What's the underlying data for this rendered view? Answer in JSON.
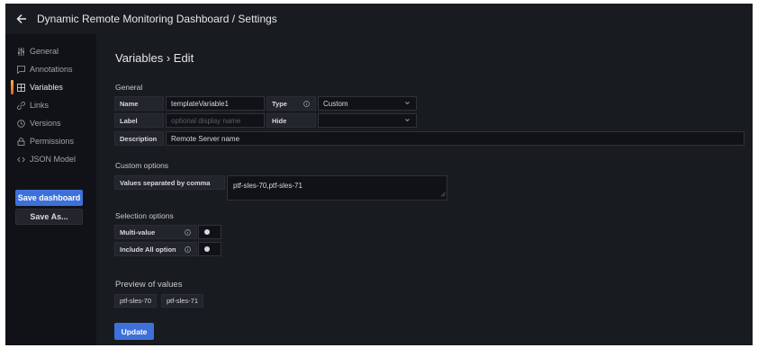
{
  "header": {
    "title": "Dynamic Remote Monitoring Dashboard / Settings"
  },
  "sidebar": {
    "items": [
      {
        "label": "General",
        "icon": "sliders-icon"
      },
      {
        "label": "Annotations",
        "icon": "comment-icon"
      },
      {
        "label": "Variables",
        "icon": "calculator-icon",
        "active": true
      },
      {
        "label": "Links",
        "icon": "link-icon"
      },
      {
        "label": "Versions",
        "icon": "history-icon"
      },
      {
        "label": "Permissions",
        "icon": "lock-icon"
      },
      {
        "label": "JSON Model",
        "icon": "code-icon"
      }
    ],
    "save_dashboard": "Save dashboard",
    "save_as": "Save As..."
  },
  "main": {
    "heading": "Variables › Edit",
    "general": {
      "section_title": "General",
      "name_label": "Name",
      "name_value": "templateVariable1",
      "type_label": "Type",
      "type_value": "Custom",
      "label_label": "Label",
      "label_placeholder": "optional display name",
      "hide_label": "Hide",
      "hide_value": "",
      "description_label": "Description",
      "description_value": "Remote Server name"
    },
    "custom_options": {
      "section_title": "Custom options",
      "values_label": "Values separated by comma",
      "values_value": "ptf-sles-70,ptf-sles-71"
    },
    "selection_options": {
      "section_title": "Selection options",
      "multi_value_label": "Multi-value",
      "multi_value_on": false,
      "include_all_label": "Include All option",
      "include_all_on": false
    },
    "preview": {
      "section_title": "Preview of values",
      "values": [
        "ptf-sles-70",
        "ptf-sles-71"
      ]
    },
    "update_label": "Update"
  },
  "colors": {
    "primary": "#3d71d9",
    "active_indicator": "#f5b73d"
  }
}
